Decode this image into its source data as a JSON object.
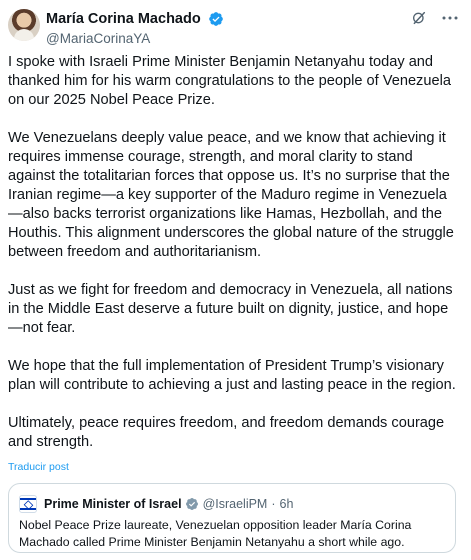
{
  "post": {
    "author": {
      "name": "María Corina Machado",
      "handle": "@MariaCorinaYA",
      "verified_badge": "blue-verified-icon",
      "badge_color": "#1d9bf0"
    },
    "actions": {
      "grok_icon": "grok-icon",
      "more_icon": "more-horizontal-icon"
    },
    "paragraphs": [
      "I spoke with Israeli Prime Minister Benjamin Netanyahu today and thanked him for his warm congratulations to the people of Venezuela on our 2025 Nobel Peace Prize.",
      "We Venezuelans deeply value peace, and we know that achieving it requires immense courage, strength, and moral clarity to stand against the totalitarian forces that oppose us. It’s no surprise that the Iranian regime—a key supporter of the Maduro regime in Venezuela—also backs terrorist organizations like Hamas, Hezbollah, and the Houthis. This alignment underscores the global nature of the struggle between freedom and authoritarianism.",
      "Just as we fight for freedom and democracy in Venezuela, all nations in the Middle East deserve a future built on dignity, justice, and hope—not fear.",
      "We hope that the full implementation of President Trump’s visionary plan will contribute to achieving a just and lasting peace in the region.",
      "Ultimately, peace requires freedom, and freedom demands courage and strength."
    ],
    "translate_label": "Traducir post",
    "link_color": "#1d9bf0"
  },
  "quoted_post": {
    "name": "Prime Minister of Israel",
    "handle": "@IsraeliPM",
    "separator": "·",
    "time": "6h",
    "badge_color": "#829aab",
    "badge_icon": "gray-verified-icon",
    "text": "Nobel Peace Prize laureate, Venezuelan opposition leader María Corina Machado called Prime Minister Benjamin Netanyahu a short while ago."
  }
}
